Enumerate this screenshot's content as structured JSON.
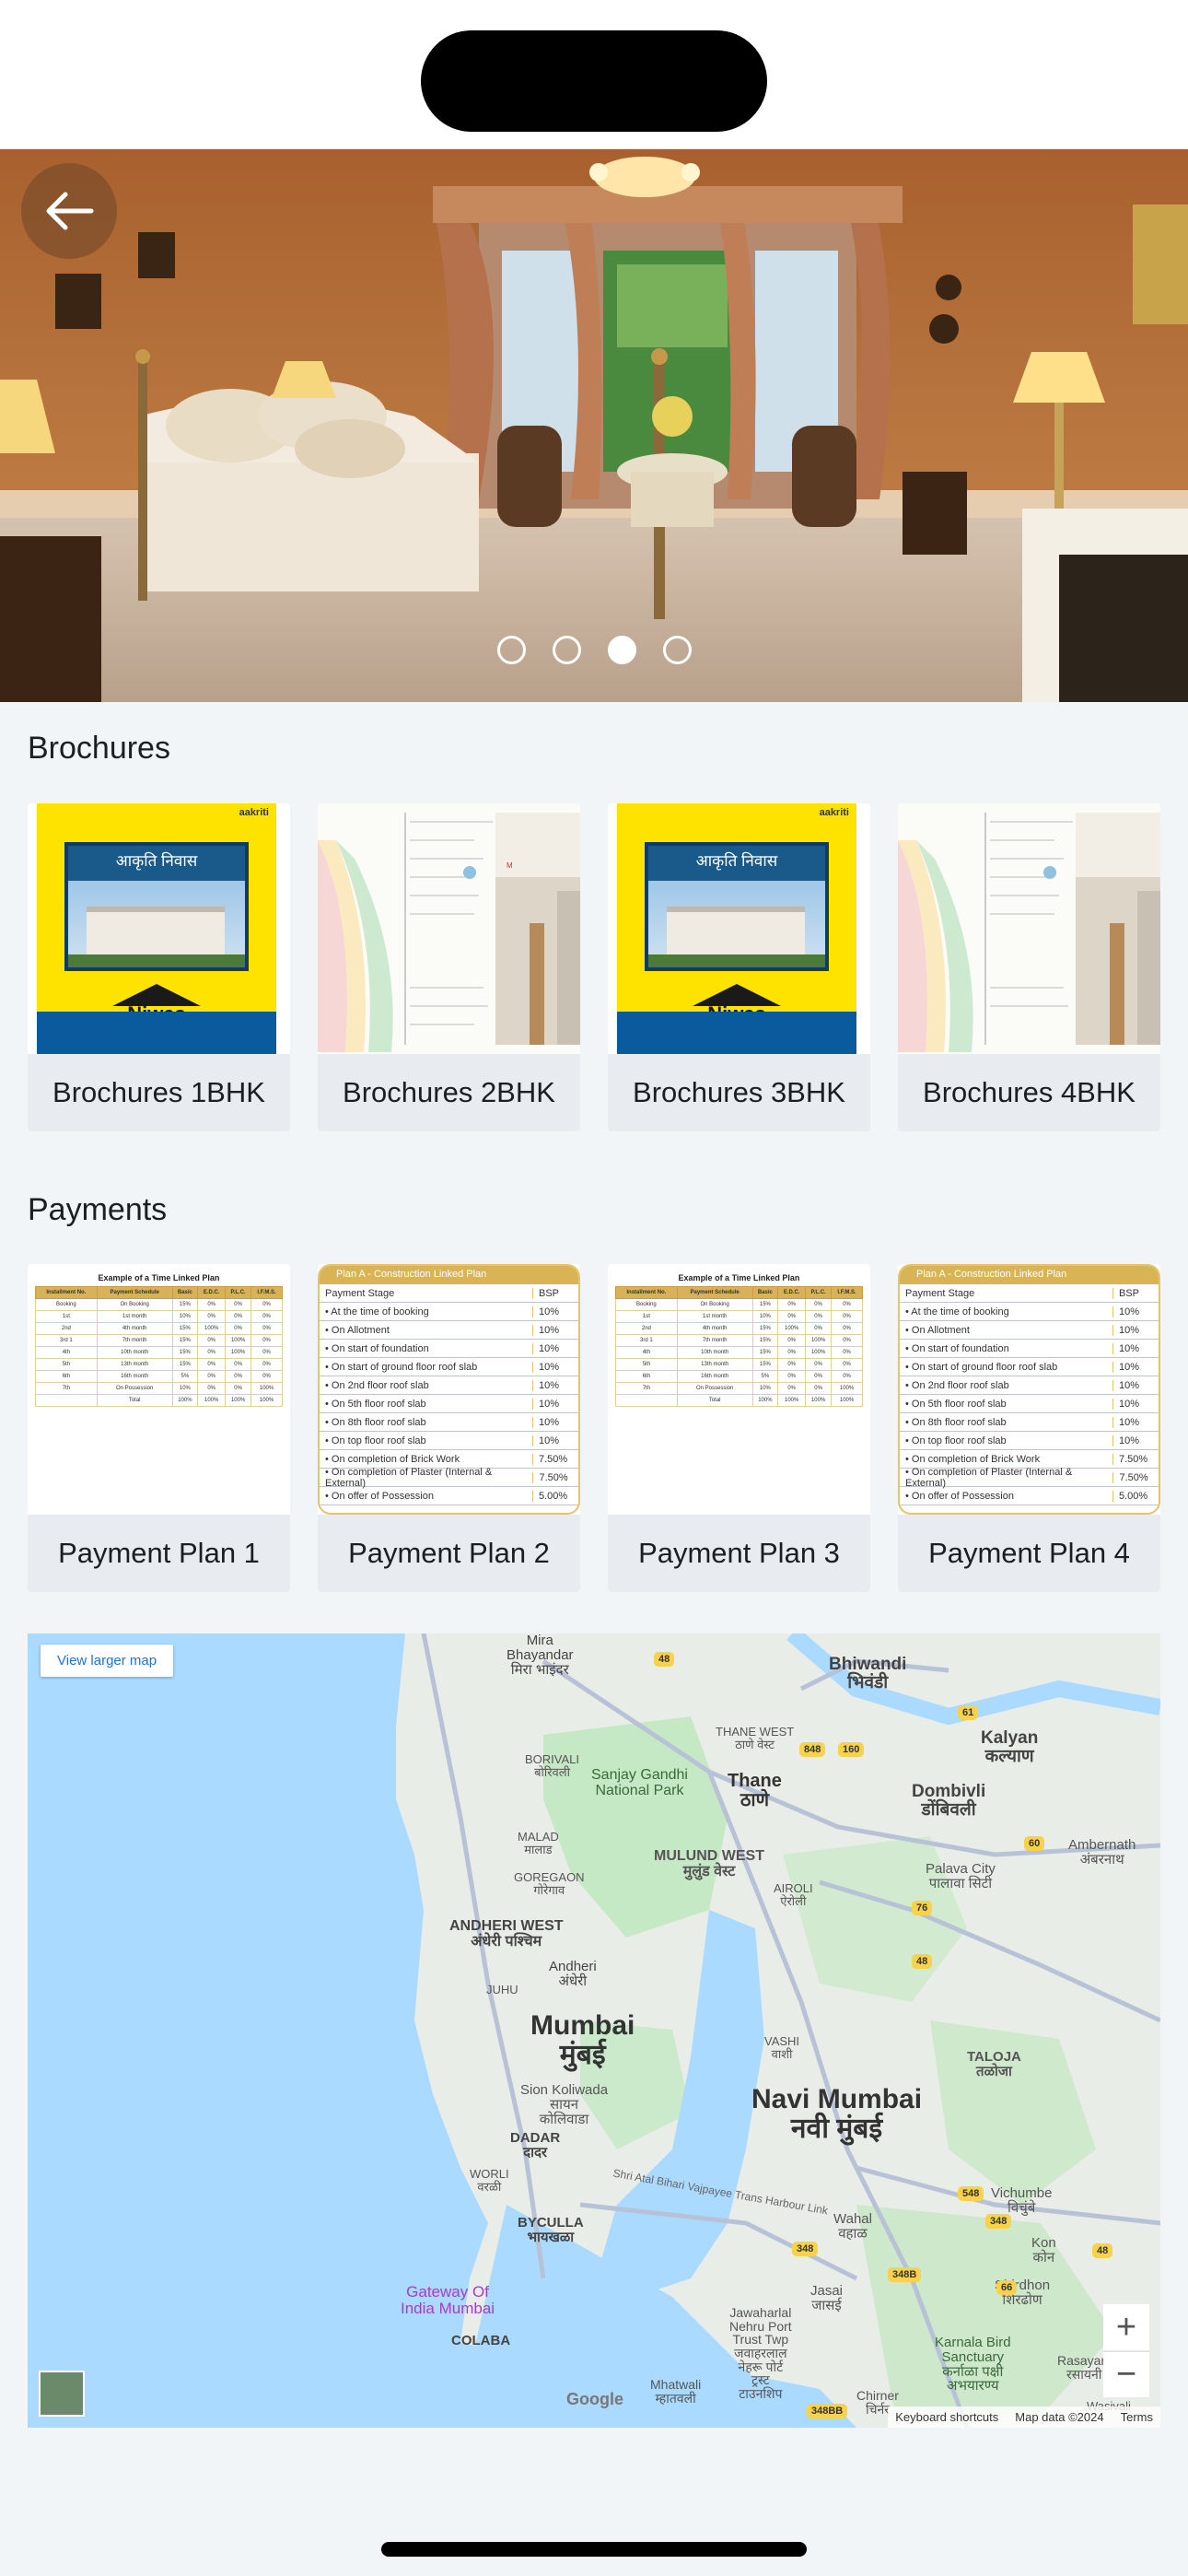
{
  "hero": {
    "slide_count": 4,
    "active_slide": 3
  },
  "brochures": {
    "title": "Brochures",
    "items": [
      {
        "label": "Brochures 1BHK"
      },
      {
        "label": "Brochures 2BHK"
      },
      {
        "label": "Brochures 3BHK"
      },
      {
        "label": "Brochures 4BHK"
      }
    ],
    "cover": {
      "brand": "aakriti",
      "hindi_title": "आकृति निवास",
      "logo_word": "Niwas"
    }
  },
  "payments": {
    "title": "Payments",
    "items": [
      {
        "label": "Payment Plan 1"
      },
      {
        "label": "Payment Plan 2"
      },
      {
        "label": "Payment Plan 3"
      },
      {
        "label": "Payment Plan 4"
      }
    ],
    "table_plan": {
      "heading": "Example of a Time Linked Plan",
      "columns": [
        "Installment No.",
        "Payment Schedule",
        "Basic",
        "E.D.C.",
        "P.L.C.",
        "I.F.M.S."
      ],
      "rows": [
        [
          "Booking",
          "On Booking",
          "15%",
          "0%",
          "0%",
          "0%"
        ],
        [
          "1st",
          "1st month",
          "10%",
          "0%",
          "0%",
          "0%"
        ],
        [
          "2nd",
          "4th month",
          "15%",
          "100%",
          "0%",
          "0%"
        ],
        [
          "3rd 1",
          "7th month",
          "15%",
          "0%",
          "100%",
          "0%"
        ],
        [
          "4th",
          "10th month",
          "15%",
          "0%",
          "100%",
          "0%"
        ],
        [
          "5th",
          "13th month",
          "15%",
          "0%",
          "0%",
          "0%"
        ],
        [
          "6th",
          "16th month",
          "5%",
          "0%",
          "0%",
          "0%"
        ],
        [
          "7th",
          "On Possession",
          "10%",
          "0%",
          "0%",
          "100%"
        ],
        [
          "",
          "Total",
          "100%",
          "100%",
          "100%",
          "100%"
        ]
      ]
    },
    "linked_plan": {
      "heading": "Plan A - Construction Linked Plan",
      "col_stage": "Payment Stage",
      "col_bsp": "BSP",
      "rows": [
        [
          "At the time of booking",
          "10%"
        ],
        [
          "On Allotment",
          "10%"
        ],
        [
          "On start of foundation",
          "10%"
        ],
        [
          "On start of ground floor roof slab",
          "10%"
        ],
        [
          "On 2nd floor roof slab",
          "10%"
        ],
        [
          "On 5th floor roof slab",
          "10%"
        ],
        [
          "On 8th floor roof slab",
          "10%"
        ],
        [
          "On top floor roof slab",
          "10%"
        ],
        [
          "On completion of Brick Work",
          "7.50%"
        ],
        [
          "On completion of Plaster (Internal & External)",
          "7.50%"
        ],
        [
          "On offer of Possession",
          "5.00%"
        ]
      ]
    }
  },
  "map": {
    "view_larger": "View larger map",
    "labels": {
      "mira": "Mira\nBhayandar\nमिरा भाइंदर",
      "bhiwandi": "Bhiwandi\nभिवंडी",
      "kalyan": "Kalyan\nकल्याण",
      "thane_west": "THANE WEST\nठाणे वेस्ट",
      "thane": "Thane\nठाणे",
      "dombivli": "Dombivli\nडोंबिवली",
      "borivali": "BORIVALI\nबोरिवली",
      "sgnp": "Sanjay Gandhi\nNational Park",
      "ambernath": "Ambernath\nअंबरनाथ",
      "malad": "MALAD\nमालाड",
      "mulund": "MULUND WEST\nमुलुंड वेस्ट",
      "goregaon": "GOREGAON\nगोरेगाव",
      "palava": "Palava City\nपालावा सिटी",
      "airoli": "AIROLI\nऐरोली",
      "andheri_west": "ANDHERI WEST\nअंधेरी पश्चिम",
      "andheri": "Andheri\nअंधेरी",
      "juhu": "JUHU",
      "mumbai": "Mumbai\nमुंबई",
      "vashi": "VASHI\nवाशी",
      "taloja": "TALOJA\nतळोजा",
      "sion": "Sion Koliwada\nसायन\nकोलिवाडा",
      "navi_mumbai": "Navi Mumbai\nनवी मुंबई",
      "dadar": "DADAR\nदादर",
      "worli": "WORLI\nवरळी",
      "atal_setu": "Shri Atal Bihari Vajpayee Trans Harbour Link",
      "vichumbe": "Vichumbe\nविचुंबे",
      "byculla": "BYCULLA\nभायखळा",
      "wahal": "Wahal\nवहाळ",
      "kon": "Kon\nकोन",
      "shirdhon": "Shirdhon\nशिरढोण",
      "gateway": "Gateway Of\nIndia Mumbai",
      "jasai": "Jasai\nजासई",
      "colaba": "COLABA",
      "jnpt": "Jawaharlal\nNehru Port\nTrust Twp\nजवाहरलाल\nनेहरू पोर्ट\nट्रस्ट\nटाउनशिप",
      "karnala": "Karnala Bird\nSanctuary\nकर्नाळा पक्षी\nअभयारण्य",
      "rasayani": "Rasayani\nरसायनी",
      "mhatwali": "Mhatwali\nम्हातवली",
      "chirner": "Chirner\nचिर्नर",
      "wasivali": "Wasivali"
    },
    "shields": [
      "48",
      "848",
      "160",
      "61",
      "60",
      "76",
      "48",
      "548",
      "348",
      "348",
      "348B",
      "66",
      "48",
      "348BB"
    ],
    "keyboard": "Keyboard shortcuts",
    "map_data": "Map data ©2024",
    "terms": "Terms",
    "google": "Google"
  },
  "icons": {
    "back": "arrow-left-icon",
    "zoom_in": "plus-icon",
    "zoom_out": "minus-icon"
  },
  "colors": {
    "page_bg": "#f2f5f8",
    "card_bg": "#e8ecf0",
    "map_water": "#aadaff",
    "map_land": "#e9ede7"
  }
}
